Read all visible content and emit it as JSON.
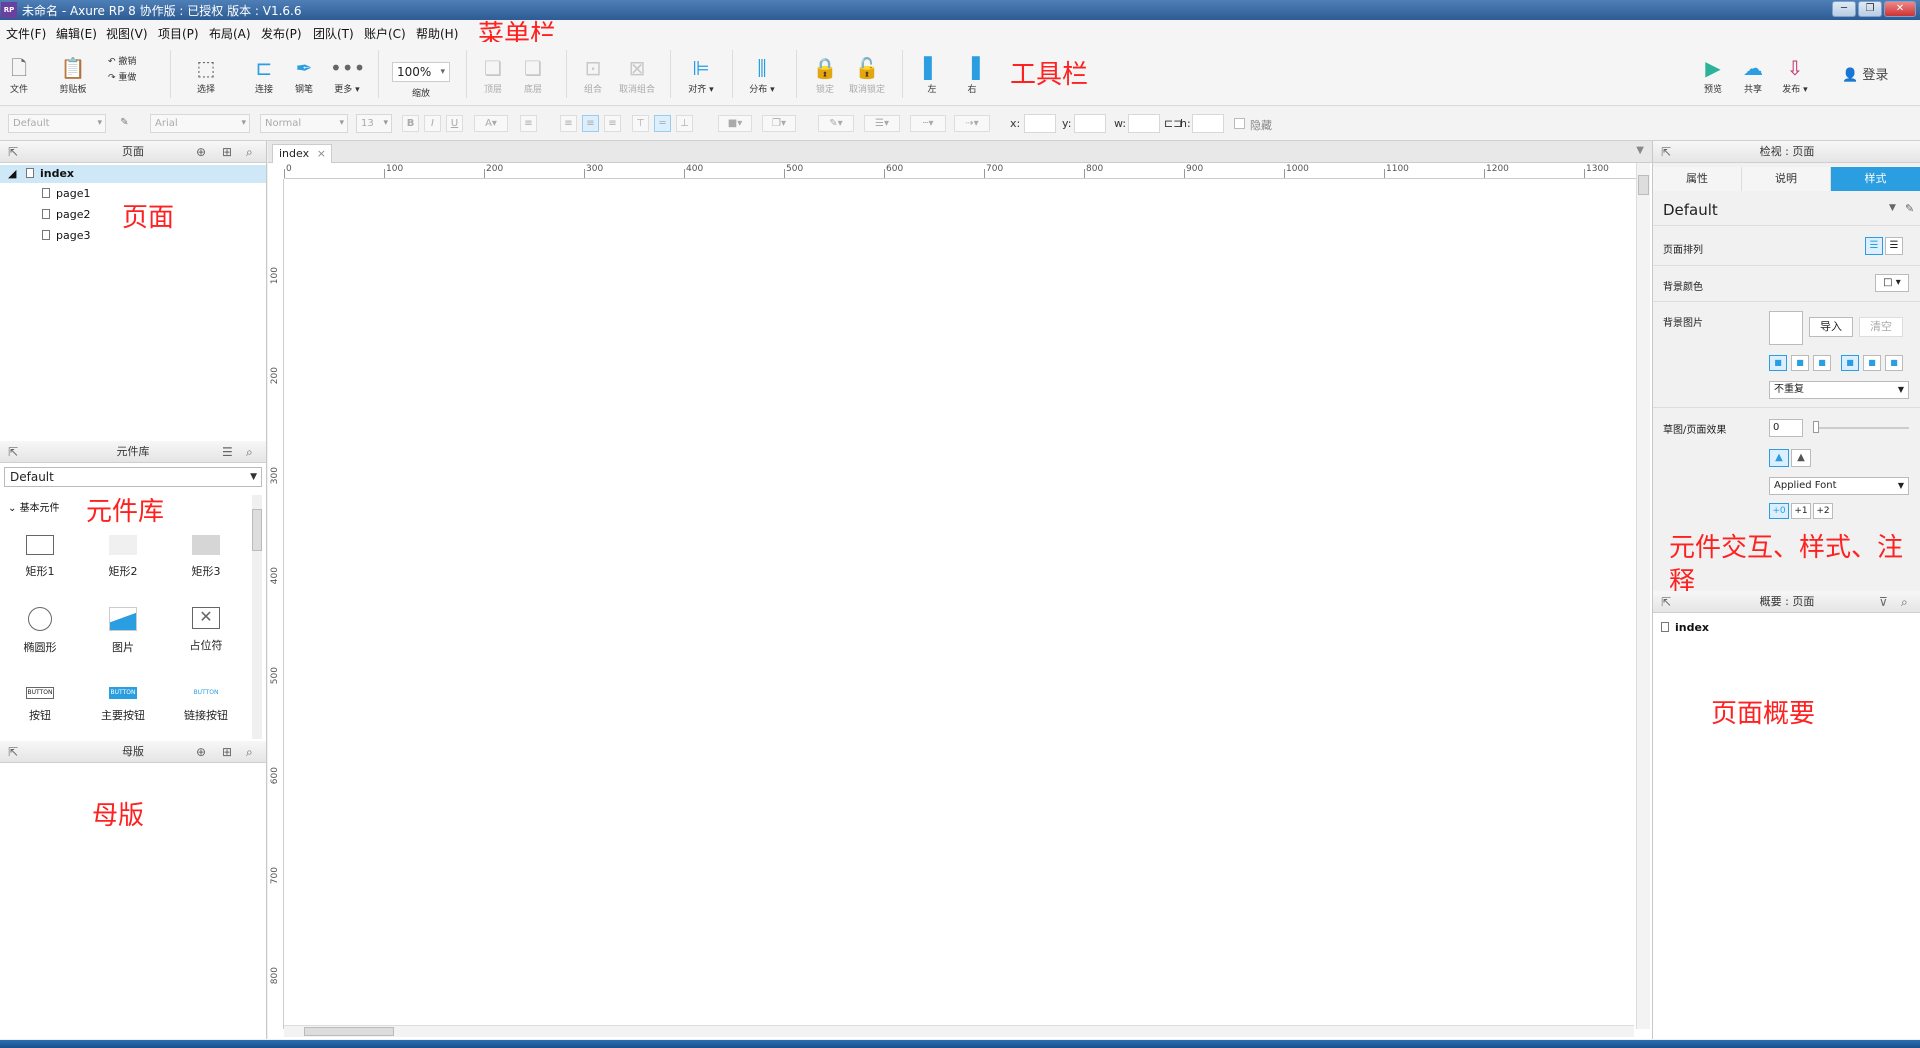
{
  "titlebar": {
    "logo": "RP",
    "title": "未命名 - Axure RP 8 协作版 : 已授权 版本 : V1.6.6",
    "controls": [
      "─",
      "❐",
      "✕"
    ]
  },
  "menu": [
    "文件(F)",
    "编辑(E)",
    "视图(V)",
    "项目(P)",
    "布局(A)",
    "发布(P)",
    "团队(T)",
    "账户(C)",
    "帮助(H)"
  ],
  "toolbar": {
    "file": "文件",
    "clipboard": "剪贴板",
    "undo": "撤销",
    "redo": "重做",
    "select": "选择",
    "connect": "连接",
    "pen": "钢笔",
    "more": "更多 ▾",
    "zoom": "100%",
    "zoom_label": "缩放",
    "top": "顶层",
    "bottom": "底层",
    "group": "组合",
    "ungroup": "取消组合",
    "align": "对齐 ▾",
    "distribute": "分布 ▾",
    "lock": "锁定",
    "unlock": "取消锁定",
    "left": "左",
    "right": "右",
    "preview": "预览",
    "share": "共享",
    "publish": "发布 ▾",
    "login": "登录"
  },
  "formatbar": {
    "style": "Default",
    "font": "Arial",
    "weight": "Normal",
    "size": "13",
    "x": "x:",
    "y": "y:",
    "w": "w:",
    "h": "h:",
    "hidden": "隐藏"
  },
  "pages_panel": {
    "title": "页面",
    "root": "index",
    "items": [
      "page1",
      "page2",
      "page3"
    ]
  },
  "library_panel": {
    "title": "元件库",
    "selected": "Default",
    "group": "基本元件",
    "widgets": [
      "矩形1",
      "矩形2",
      "矩形3",
      "椭圆形",
      "图片",
      "占位符",
      "按钮",
      "主要按钮",
      "链接按钮"
    ],
    "button_text": "BUTTON"
  },
  "masters_panel": {
    "title": "母版"
  },
  "canvas": {
    "tab": "index",
    "ruler_h": [
      "0",
      "100",
      "200",
      "300",
      "400",
      "500",
      "600",
      "700",
      "800",
      "900",
      "1000",
      "1100",
      "1200",
      "1300"
    ],
    "ruler_v": [
      "100",
      "200",
      "300",
      "400",
      "500",
      "600",
      "700",
      "800"
    ]
  },
  "inspector": {
    "title": "检视 : 页面",
    "tabs": [
      "属性",
      "说明",
      "样式"
    ],
    "style_name": "Default",
    "page_align": "页面排列",
    "bg_color": "背景颜色",
    "bg_image": "背景图片",
    "import": "导入",
    "clear": "清空",
    "repeat": "不重复",
    "sketch": "草图/页面效果",
    "sketch_value": "0",
    "font": "Applied Font",
    "font_steps": [
      "+0",
      "+1",
      "+2"
    ]
  },
  "outline_panel": {
    "title": "概要 : 页面",
    "item": "index"
  },
  "annotations": {
    "menubar": "菜单栏",
    "toolbar": "工具栏",
    "pages": "页面",
    "library": "元件库",
    "inspector": "元件交互、样式、注释",
    "outline": "页面概要",
    "masters": "母版"
  },
  "colors": {
    "accent": "#2a9ee0",
    "annotation": "#ff2020"
  }
}
